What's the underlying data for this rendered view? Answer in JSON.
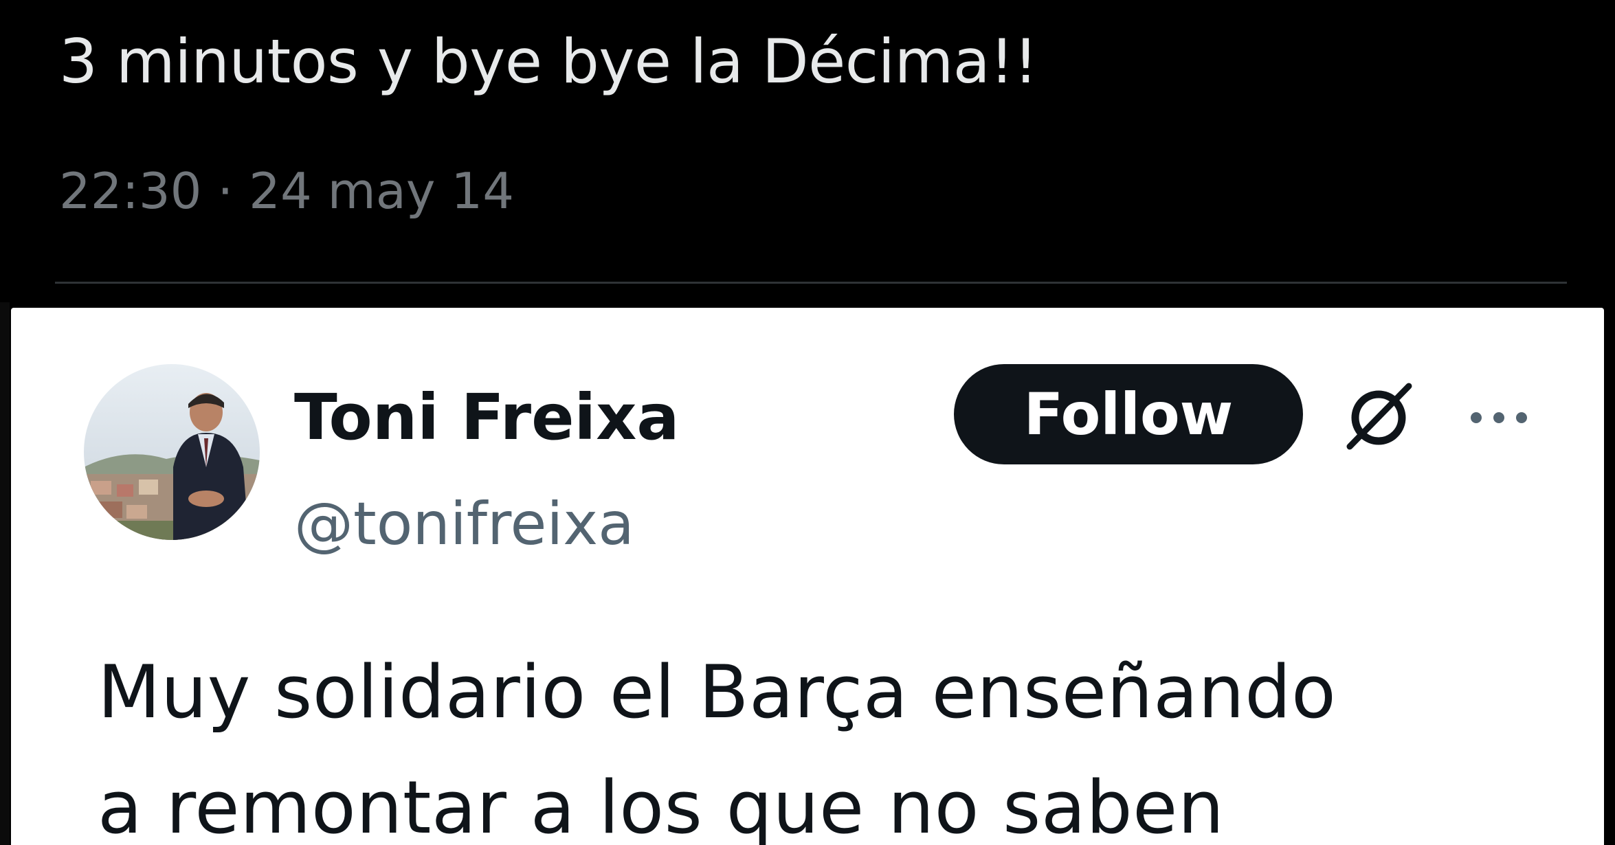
{
  "parent_tweet": {
    "text": "3 minutos y bye bye la Décima!!",
    "timestamp": "22:30 · 24 may 14"
  },
  "quoted_tweet": {
    "author": {
      "name": "Toni Freixa",
      "handle": "@tonifreixa"
    },
    "follow_label": "Follow",
    "body_lines": [
      "Muy solidario el Barça enseñando",
      "a remontar a los que no saben"
    ]
  },
  "icons": {
    "x_logo": "x-logo-icon",
    "more": "more-options-icon"
  },
  "colors": {
    "dark_bg": "#000000",
    "dark_text": "#e7e9ea",
    "dark_meta": "#71767b",
    "card_bg": "#ffffff",
    "primary_text": "#0f1419",
    "secondary_text": "#536471",
    "follow_bg": "#0f1419"
  }
}
